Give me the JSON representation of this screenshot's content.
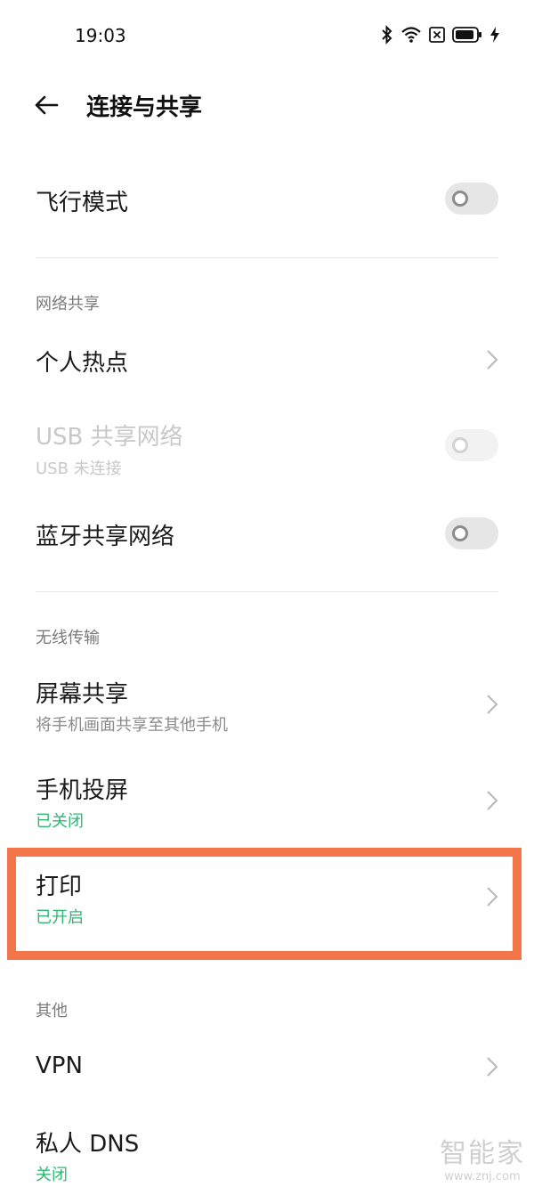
{
  "status_bar": {
    "time": "19:03"
  },
  "header": {
    "title": "连接与共享"
  },
  "airplane": {
    "label": "飞行模式"
  },
  "sections": {
    "tethering": "网络共享",
    "wireless": "无线传输",
    "other": "其他"
  },
  "items": {
    "hotspot": {
      "label": "个人热点"
    },
    "usb": {
      "label": "USB 共享网络",
      "sub": "USB 未连接"
    },
    "bt_tether": {
      "label": "蓝牙共享网络"
    },
    "screen_share": {
      "label": "屏幕共享",
      "sub": "将手机画面共享至其他手机"
    },
    "cast": {
      "label": "手机投屏",
      "sub": "已关闭"
    },
    "print": {
      "label": "打印",
      "sub": "已开启"
    },
    "vpn": {
      "label": "VPN"
    },
    "dns": {
      "label": "私人 DNS",
      "sub": "关闭"
    }
  },
  "watermark": {
    "logo": "智能家",
    "url": "www.znj.com"
  },
  "colors": {
    "status_green": "#2eb872",
    "highlight": "#f3764a"
  }
}
